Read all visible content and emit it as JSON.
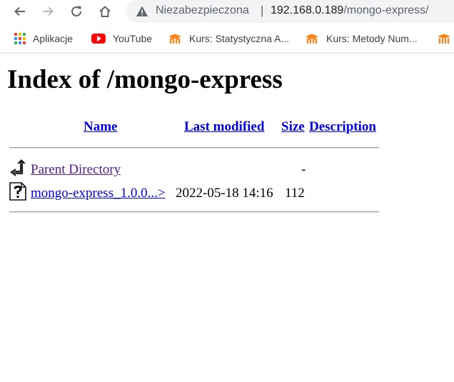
{
  "browser": {
    "omnibox": {
      "security_label": "Niezabezpieczona",
      "separator": "|",
      "host": "192.168.0.189",
      "path": "/mongo-express/"
    },
    "nav_icons": [
      "back-arrow-icon",
      "forward-arrow-icon",
      "reload-icon",
      "home-icon"
    ]
  },
  "bookmarks": {
    "items": [
      {
        "label": "Aplikacje",
        "icon": "apps-grid-icon"
      },
      {
        "label": "YouTube",
        "icon": "youtube-icon"
      },
      {
        "label": "Kurs: Statystyczna A...",
        "icon": "moodle-icon"
      },
      {
        "label": "Kurs: Metody Num...",
        "icon": "moodle-icon"
      }
    ]
  },
  "listing": {
    "title": "Index of /mongo-express",
    "columns": {
      "name": "Name",
      "last_modified": "Last modified",
      "size": "Size",
      "description": "Description"
    },
    "rows": [
      {
        "icon": "parent-directory-icon",
        "name": "Parent Directory",
        "last_modified": "",
        "size": "-",
        "description": ""
      },
      {
        "icon": "unknown-file-icon",
        "name": "mongo-express_1.0.0...>",
        "last_modified": "2022-05-18 14:16",
        "size": "112",
        "description": ""
      }
    ]
  },
  "colors": {
    "link": "#0000ee",
    "visited_link": "#551a8b",
    "omnibox_bg": "#f1f3f4"
  }
}
